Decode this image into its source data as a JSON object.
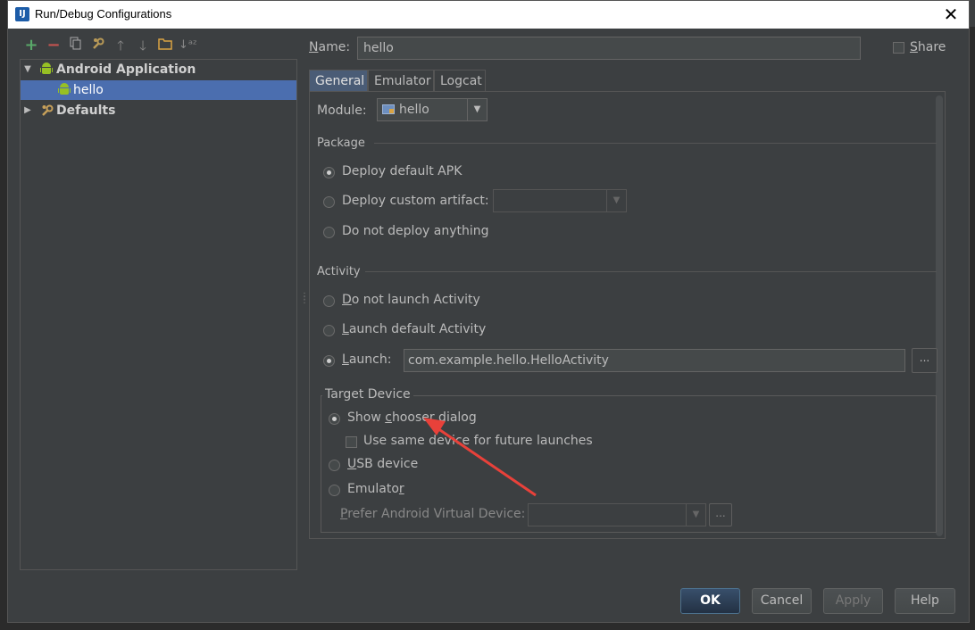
{
  "window": {
    "title": "Run/Debug Configurations",
    "app_icon_text": "IJ",
    "close_glyph": "✕"
  },
  "toolbar": {
    "add_icon": "plus-icon",
    "remove_icon": "minus-icon",
    "copy_icon": "copy-icon",
    "edit_defaults_icon": "wrench-icon",
    "move_up_icon": "arrow-up-icon",
    "move_down_icon": "arrow-down-icon",
    "folder_icon": "folder-icon",
    "sort_icon": "sort-icon"
  },
  "tree": {
    "items": [
      {
        "label": "Android Application",
        "bold": true,
        "expanded": true
      },
      {
        "label": "hello",
        "selected": true
      },
      {
        "label": "Defaults",
        "bold": true,
        "expanded": false
      }
    ]
  },
  "name_field": {
    "label_prefix": "N",
    "label_rest": "ame:",
    "value": "hello"
  },
  "share": {
    "label_prefix": "S",
    "label_rest": "hare",
    "checked": false
  },
  "tabs": [
    {
      "label": "General",
      "active": true
    },
    {
      "label": "Emulator",
      "active": false
    },
    {
      "label": "Logcat",
      "active": false
    }
  ],
  "module": {
    "label": "Module:",
    "value": "hello"
  },
  "package": {
    "title": "Package",
    "options": [
      {
        "label": "Deploy default APK",
        "checked": true
      },
      {
        "label": "Deploy custom artifact:",
        "checked": false
      },
      {
        "label": "Do not deploy anything",
        "checked": false
      }
    ]
  },
  "activity": {
    "title": "Activity",
    "options": [
      {
        "label_prefix": "D",
        "label_rest": "o not launch Activity",
        "checked": false
      },
      {
        "label_prefix": "L",
        "label_rest": "aunch default Activity",
        "checked": false
      },
      {
        "label_prefix": "L",
        "label_rest": "aunch:",
        "checked": true
      }
    ],
    "launch_value": "com.example.hello.HelloActivity",
    "browse_label": "..."
  },
  "target_device": {
    "title": "Target Device",
    "show_chooser_pre": "Show ",
    "show_chooser_u": "c",
    "show_chooser_post": "hooser dialog",
    "same_device_label": "Use same device for future launches",
    "usb_prefix": "U",
    "usb_rest": "SB device",
    "emulator_pre": "Emulato",
    "emulator_u": "r",
    "prefer_prefix": "P",
    "prefer_rest": "refer Android Virtual Device:",
    "browse_label": "...",
    "selected": "Show chooser dialog"
  },
  "buttons": {
    "ok": "OK",
    "cancel": "Cancel",
    "apply": "Apply",
    "help": "Help"
  },
  "colors": {
    "background": "#3c3f41",
    "selection": "#4b6eaf",
    "active_tab": "#4a5c76",
    "annotation_arrow": "#e8413a",
    "android_green": "#97c024"
  }
}
